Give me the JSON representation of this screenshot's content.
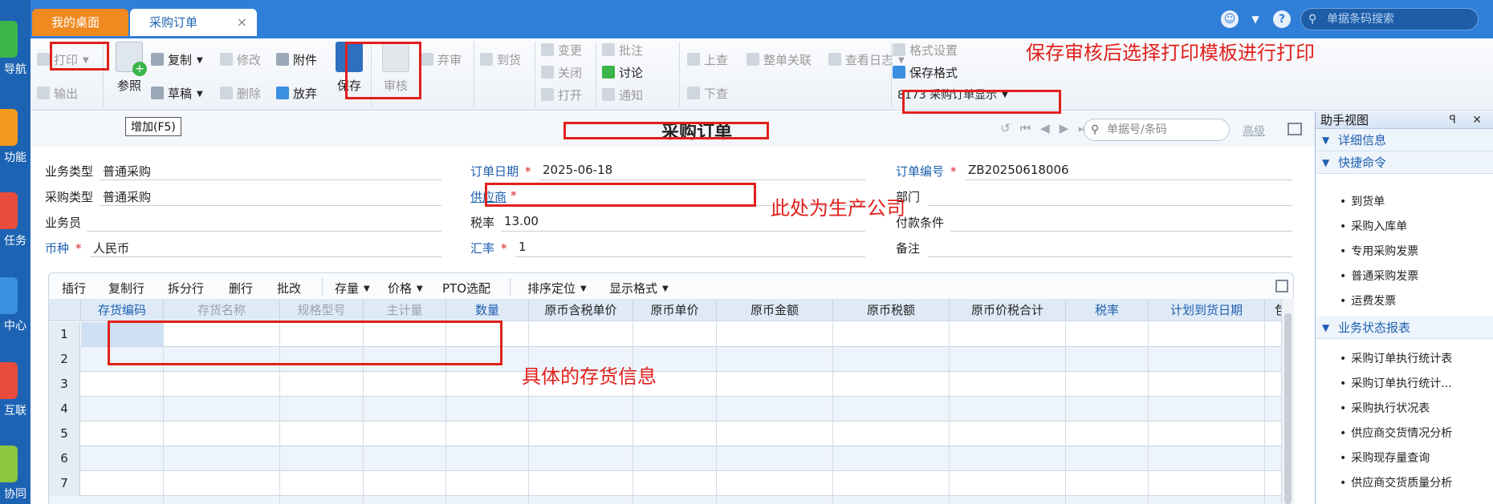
{
  "leftnav": {
    "items": [
      {
        "label": "导航",
        "color": "#3bb54a",
        "icon": "grid-icon"
      },
      {
        "label": "功能",
        "color": "#f39a1e",
        "icon": "function-icon"
      },
      {
        "label": "任务",
        "color": "#e74c3c",
        "icon": "task-icon"
      },
      {
        "label": "中心",
        "color": "#3b8fe0",
        "icon": "center-icon"
      },
      {
        "label": "互联",
        "color": "#e74c3c",
        "icon": "connect-icon"
      },
      {
        "label": "协同",
        "color": "#8cc63f",
        "icon": "collab-icon"
      }
    ]
  },
  "tabs": {
    "desktop": "我的桌面",
    "purchase_order": "采购订单",
    "close": "×"
  },
  "topbar": {
    "barcode_placeholder": "单据条码搜索"
  },
  "toolbar": {
    "print": "打印",
    "export": "输出",
    "reference": "参照",
    "copy": "复制",
    "draft": "草稿",
    "modify": "修改",
    "delete": "删除",
    "attachment": "附件",
    "abandon": "放弃",
    "save": "保存",
    "audit": "审核",
    "discard": "弃审",
    "arrival": "到货",
    "change": "变更",
    "close": "关闭",
    "open": "打开",
    "annotate": "批注",
    "discuss": "讨论",
    "notify": "通知",
    "look_up": "上查",
    "look_down": "下查",
    "link_all": "整单关联",
    "view_log": "查看日志",
    "format_settings": "格式设置",
    "save_format": "保存格式",
    "template": "8173 采购订单显示"
  },
  "tooltip": "增加(F5)",
  "titlebar": {
    "title": "采购订单",
    "search_placeholder": "单据号/条码",
    "advanced": "高级"
  },
  "form": {
    "business_type": {
      "label": "业务类型",
      "value": "普通采购"
    },
    "purchase_type": {
      "label": "采购类型",
      "value": "普通采购"
    },
    "salesman": {
      "label": "业务员",
      "value": ""
    },
    "currency": {
      "label": "币种",
      "value": "人民币"
    },
    "order_date": {
      "label": "订单日期",
      "value": "2025-06-18"
    },
    "supplier": {
      "label": "供应商",
      "value": ""
    },
    "tax_rate": {
      "label": "税率",
      "value": "13.00"
    },
    "exchange_rate": {
      "label": "汇率",
      "value": "1"
    },
    "order_no": {
      "label": "订单编号",
      "value": "ZB20250618006"
    },
    "department": {
      "label": "部门",
      "value": ""
    },
    "payment_terms": {
      "label": "付款条件",
      "value": ""
    },
    "remark": {
      "label": "备注",
      "value": ""
    },
    "required_mark": "*"
  },
  "gridbar": {
    "insert_row": "插行",
    "copy_row": "复制行",
    "split_row": "拆分行",
    "delete_row": "删行",
    "batch_edit": "批改",
    "stock": "存量",
    "price": "价格",
    "pto": "PTO选配",
    "sort": "排序定位",
    "display_format": "显示格式"
  },
  "grid": {
    "headers": [
      "存货编码",
      "存货名称",
      "规格型号",
      "主计量",
      "数量",
      "原币含税单价",
      "原币单价",
      "原币金额",
      "原币税额",
      "原币价税合计",
      "税率",
      "计划到货日期",
      "包"
    ],
    "row_numbers": [
      "1",
      "2",
      "3",
      "4",
      "5",
      "6",
      "7"
    ]
  },
  "helper": {
    "title": "助手视图",
    "controls": "ꟼ ✕",
    "sections": {
      "detail": "详细信息",
      "shortcuts": "快捷命令",
      "reports": "业务状态报表"
    },
    "shortcut_items": [
      "到货单",
      "采购入库单",
      "专用采购发票",
      "普通采购发票",
      "运费发票"
    ],
    "report_items": [
      "采购订单执行统计表",
      "采购订单执行统计...",
      "采购执行状况表",
      "供应商交货情况分析",
      "采购现存量查询",
      "供应商交货质量分析"
    ]
  },
  "annotations": {
    "print_note": "保存审核后选择打印模板进行打印",
    "supplier_note": "此处为生产公司",
    "inventory_note": "具体的存货信息"
  },
  "colors": {
    "accent": "#2f7ed8",
    "annotation": "#e0201c",
    "tab_orange": "#f0891f"
  }
}
